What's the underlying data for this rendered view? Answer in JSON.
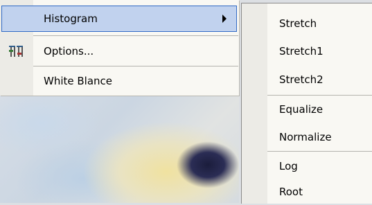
{
  "main_menu": {
    "items": [
      {
        "label": "Histogram",
        "has_submenu": true,
        "highlighted": true
      },
      {
        "label": "Options...",
        "icon": "options-icon"
      },
      {
        "label": "White Blance"
      }
    ]
  },
  "submenu": {
    "items": [
      {
        "label": "Stretch"
      },
      {
        "label": "Stretch1"
      },
      {
        "label": "Stretch2"
      },
      {
        "label": "Equalize"
      },
      {
        "label": "Normalize"
      },
      {
        "label": "Log"
      },
      {
        "label": "Root"
      }
    ]
  },
  "colors": {
    "highlight_bg": "#c1d2ee",
    "highlight_border": "#316ac5",
    "menu_bg": "#f9f8f3",
    "gutter": "#ecebe6"
  }
}
